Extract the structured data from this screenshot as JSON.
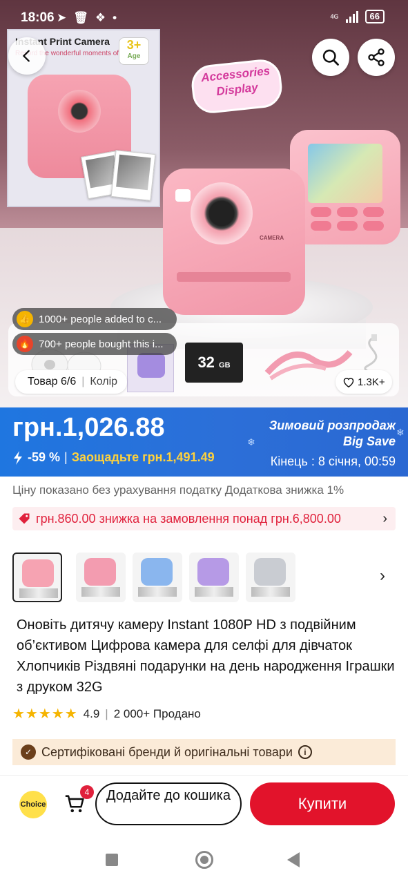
{
  "status_bar": {
    "time": "18:06",
    "battery": "66",
    "network": "4G"
  },
  "hero": {
    "box_title": "Instant Print Camera",
    "box_subtitle": "Record the wonderful moments of kids",
    "box_age_num": "3+",
    "box_age_label": "Age",
    "accessories_label": "Accessories Display",
    "sd_card_label": "32",
    "sd_card_unit": "GB",
    "camera_label": "CAMERA",
    "social_proof": [
      {
        "icon": "thumbs-up-icon",
        "text": "1000+ people added to c..."
      },
      {
        "icon": "fire-icon",
        "text": "700+ people bought this i..."
      }
    ],
    "image_counter": "Товар 6/6",
    "color_label": "Колір",
    "likes": "1.3K+"
  },
  "price": {
    "amount": "грн.1,026.88",
    "discount_pct": "-59 %",
    "divider": "|",
    "savings": "Заощадьте грн.1,491.49",
    "sale_title": "Зимовий розпродаж",
    "sale_subtitle": "Big Save",
    "sale_end": "Кінець :  8 січня, 00:59"
  },
  "tax_note": "Ціну показано без урахування податку Додаткова знижка 1%",
  "coupon": {
    "text": "грн.860.00 знижка на замовлення понад грн.6,800.00"
  },
  "variants": [
    {
      "color": "#f6a3b2",
      "selected": true
    },
    {
      "color": "#f39cb0",
      "selected": false
    },
    {
      "color": "#8ab6ee",
      "selected": false
    },
    {
      "color": "#b69ae6",
      "selected": false
    },
    {
      "color": "#c9ccd2",
      "selected": false
    }
  ],
  "product_title": "Оновіть дитячу камеру Instant 1080P HD з подвійним об’єктивом Цифрова камера для селфі для дівчаток Хлопчиків Різдвяні подарунки на день народження Іграшки з друком 32G",
  "rating": {
    "stars": "★★★★★",
    "score": "4.9",
    "divider": "|",
    "sold": "2 000+ Продано"
  },
  "certified": "Сертифіковані бренди й оригінальні товари",
  "bottom": {
    "choice_label": "Choice",
    "cart_count": "4",
    "add_to_cart": "Додайте до кошика",
    "buy": "Купити"
  },
  "colors": {
    "price_blue": "#2c6fd8",
    "buy_red": "#e2132b",
    "savings_yellow": "#ffd23c",
    "coupon_red": "#e0213c"
  }
}
